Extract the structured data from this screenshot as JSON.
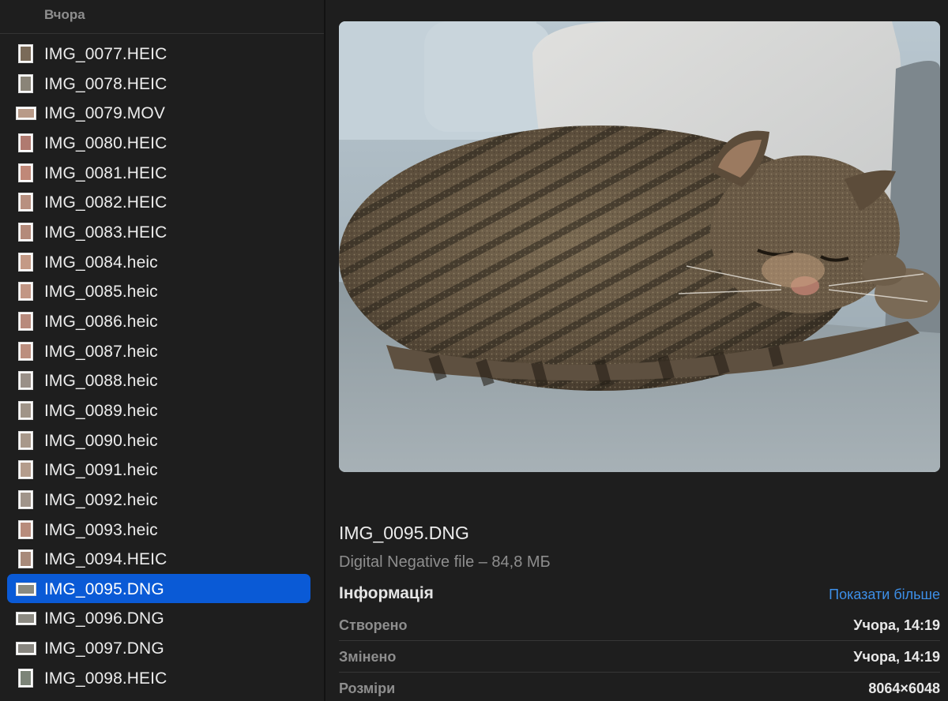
{
  "file_list": {
    "section_header": "Вчора",
    "selected_index": 18,
    "items": [
      {
        "name": "IMG_0077.HEIC",
        "thumb": "portrait",
        "tint": "#7a6a58"
      },
      {
        "name": "IMG_0078.HEIC",
        "thumb": "portrait",
        "tint": "#8a8478"
      },
      {
        "name": "IMG_0079.MOV",
        "thumb": "video",
        "tint": "#b89a88"
      },
      {
        "name": "IMG_0080.HEIC",
        "thumb": "portrait",
        "tint": "#b07a70"
      },
      {
        "name": "IMG_0081.HEIC",
        "thumb": "portrait",
        "tint": "#c08878"
      },
      {
        "name": "IMG_0082.HEIC",
        "thumb": "portrait",
        "tint": "#b89080"
      },
      {
        "name": "IMG_0083.HEIC",
        "thumb": "portrait",
        "tint": "#b48a7a"
      },
      {
        "name": "IMG_0084.heic",
        "thumb": "portrait",
        "tint": "#c49a86"
      },
      {
        "name": "IMG_0085.heic",
        "thumb": "portrait",
        "tint": "#c29684"
      },
      {
        "name": "IMG_0086.heic",
        "thumb": "portrait",
        "tint": "#b88a7c"
      },
      {
        "name": "IMG_0087.heic",
        "thumb": "portrait",
        "tint": "#bc8e7e"
      },
      {
        "name": "IMG_0088.heic",
        "thumb": "portrait",
        "tint": "#9a9088"
      },
      {
        "name": "IMG_0089.heic",
        "thumb": "portrait",
        "tint": "#a09488"
      },
      {
        "name": "IMG_0090.heic",
        "thumb": "portrait",
        "tint": "#a8988a"
      },
      {
        "name": "IMG_0091.heic",
        "thumb": "portrait",
        "tint": "#b49c8c"
      },
      {
        "name": "IMG_0092.heic",
        "thumb": "portrait",
        "tint": "#a0948a"
      },
      {
        "name": "IMG_0093.heic",
        "thumb": "portrait",
        "tint": "#b88c7c"
      },
      {
        "name": "IMG_0094.HEIC",
        "thumb": "portrait",
        "tint": "#a88a7a"
      },
      {
        "name": "IMG_0095.DNG",
        "thumb": "landscape",
        "tint": "#8a8a80"
      },
      {
        "name": "IMG_0096.DNG",
        "thumb": "landscape",
        "tint": "#8c8a82"
      },
      {
        "name": "IMG_0097.DNG",
        "thumb": "landscape",
        "tint": "#888680"
      },
      {
        "name": "IMG_0098.HEIC",
        "thumb": "portrait",
        "tint": "#7c8478"
      }
    ]
  },
  "preview": {
    "image_alt": "cat-photo",
    "file_name": "IMG_0095.DNG",
    "file_kind": "Digital Negative file – 84,8 МБ",
    "info_title": "Інформація",
    "show_more": "Показати більше",
    "rows": [
      {
        "key": "Створено",
        "value": "Учора, 14:19"
      },
      {
        "key": "Змінено",
        "value": "Учора, 14:19"
      },
      {
        "key": "Розміри",
        "value": "8064×6048"
      }
    ]
  },
  "colors": {
    "background": "#1e1e1e",
    "selection": "#0a5ad6",
    "link": "#3d8fe8",
    "secondary_text": "#8e8e8e",
    "primary_text": "#ececec"
  }
}
